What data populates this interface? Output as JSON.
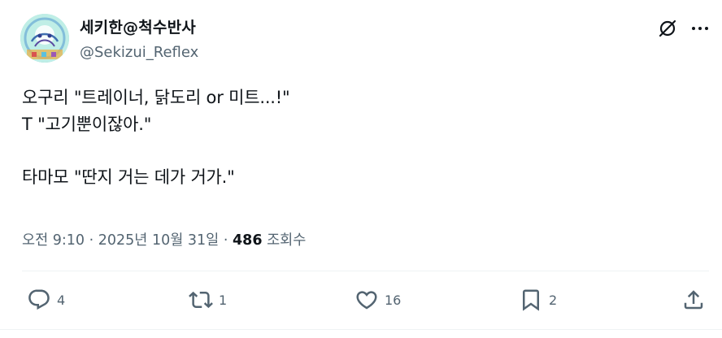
{
  "author": {
    "display_name": "세키한@척수반사",
    "handle": "@Sekizui_Reflex",
    "avatar_icon": "avatar-image"
  },
  "header_actions": {
    "grok_icon": "grok-icon",
    "more_icon": "more-icon"
  },
  "tweet": {
    "text": "오구리 \"트레이너, 닭도리 or 미트...!\"\nT \"고기뿐이잖아.\"\n\n타마모 \"딴지 거는 데가 거가.\""
  },
  "meta": {
    "time": "오전 9:10",
    "separator": " · ",
    "date": "2025년 10월 31일",
    "views_count": "486",
    "views_label": " 조회수"
  },
  "actions": {
    "reply_count": "4",
    "retweet_count": "1",
    "like_count": "16",
    "bookmark_count": "2"
  },
  "colors": {
    "text_primary": "#0f1419",
    "text_secondary": "#536471",
    "divider": "#eff3f4"
  }
}
